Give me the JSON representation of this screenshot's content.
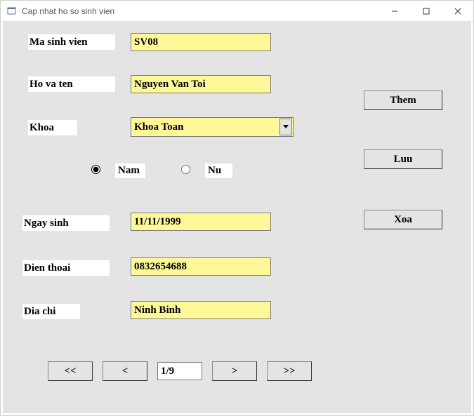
{
  "window": {
    "title": "Cap nhat ho so sinh vien"
  },
  "labels": {
    "ma_sv": "Ma sinh vien",
    "ho_ten": "Ho va ten",
    "khoa": "Khoa",
    "nam": "Nam",
    "nu": "Nu",
    "ngay_sinh": "Ngay sinh",
    "dien_thoai": "Dien thoai",
    "dia_chi": "Dia chi"
  },
  "fields": {
    "ma_sv": "SV08",
    "ho_ten": "Nguyen Van Toi",
    "khoa": "Khoa Toan",
    "ngay_sinh": "11/11/1999",
    "dien_thoai": "0832654688",
    "dia_chi": "Ninh Binh"
  },
  "gender": {
    "selected": "nam"
  },
  "buttons": {
    "them": "Them",
    "luu": "Luu",
    "xoa": "Xoa",
    "first": "<<",
    "prev": "<",
    "next": ">",
    "last": ">>"
  },
  "nav": {
    "position": "1/9"
  }
}
